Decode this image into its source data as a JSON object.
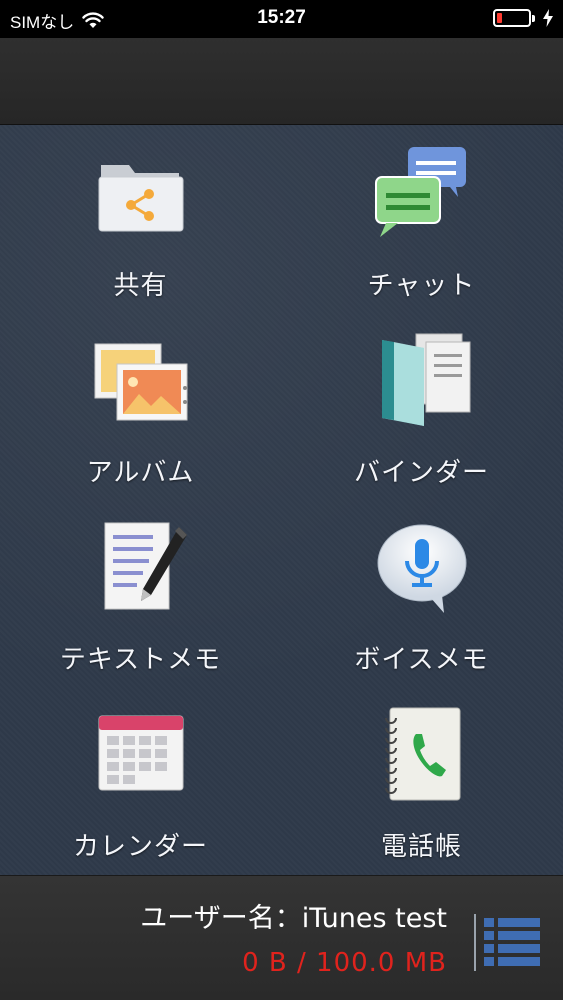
{
  "status_bar": {
    "carrier": "SIMなし",
    "time": "15:27",
    "battery_level": 0.15
  },
  "colors": {
    "grid_background": "#2f3a4a",
    "storage_text": "#e0231d",
    "menu_icon": "#3f6db3",
    "battery_low": "#ff3b30"
  },
  "grid": {
    "items": [
      {
        "label": "共有",
        "icon": "shared-folder-icon"
      },
      {
        "label": "チャット",
        "icon": "chat-bubbles-icon"
      },
      {
        "label": "アルバム",
        "icon": "photo-album-icon"
      },
      {
        "label": "バインダー",
        "icon": "binder-icon"
      },
      {
        "label": "テキストメモ",
        "icon": "text-memo-icon"
      },
      {
        "label": "ボイスメモ",
        "icon": "voice-memo-icon"
      },
      {
        "label": "カレンダー",
        "icon": "calendar-icon"
      },
      {
        "label": "電話帳",
        "icon": "phonebook-icon"
      }
    ]
  },
  "footer": {
    "user_label": "ユーザー名：iTunes test",
    "storage": "0 B / 100.0 MB",
    "menu_icon": "list-menu-icon"
  }
}
